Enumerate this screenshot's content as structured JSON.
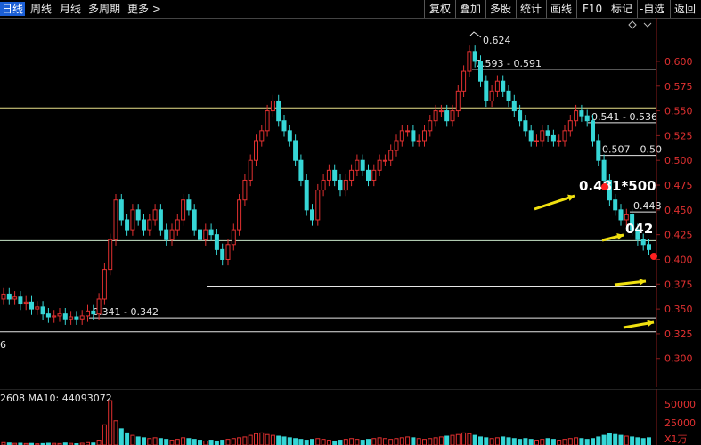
{
  "toolbar": {
    "left": [
      "日线",
      "周线",
      "月线",
      "多周期",
      "更多 >"
    ],
    "right": [
      "复权",
      "叠加",
      "多股",
      "统计",
      "画线",
      "F10",
      "标记",
      "-自选",
      "返回"
    ]
  },
  "chart_data": {
    "type": "candlestick",
    "y_ticks": [
      "0.600",
      "0.575",
      "0.550",
      "0.525",
      "0.500",
      "0.475",
      "0.450",
      "0.425",
      "0.400",
      "0.375",
      "0.350",
      "0.325",
      "0.300"
    ],
    "ylim": [
      0.28,
      0.635
    ],
    "max_label": "0.624",
    "left_edge_label": "6",
    "horizontal_levels": [
      {
        "label": "0.593 - 0.591",
        "y": 0.592,
        "color": "#e6e6e6"
      },
      {
        "label": "",
        "y": 0.553,
        "color": "#e8e08a"
      },
      {
        "label": "0.541 - 0.536",
        "y": 0.538,
        "color": "#e6e6e6"
      },
      {
        "label": "0.507 - 0.50",
        "y": 0.505,
        "color": "#e6e6e6"
      },
      {
        "label": "0.448",
        "y": 0.448,
        "color": "#e6e6e6"
      },
      {
        "label": "",
        "y": 0.419,
        "color": "#c8e6c8"
      },
      {
        "label": "",
        "y": 0.373,
        "color": "#e6e6e6"
      },
      {
        "label": "0.341 - 0.342",
        "y": 0.341,
        "color": "#e6e6e6"
      },
      {
        "label": "",
        "y": 0.327,
        "color": "#e6e6e6"
      }
    ],
    "annotations": [
      {
        "text": "0.481*500",
        "y": 0.475
      },
      {
        "text": "042",
        "y": 0.432
      }
    ],
    "series_close": [
      0.365,
      0.36,
      0.362,
      0.355,
      0.357,
      0.35,
      0.352,
      0.345,
      0.342,
      0.343,
      0.345,
      0.34,
      0.342,
      0.34,
      0.343,
      0.348,
      0.345,
      0.36,
      0.39,
      0.42,
      0.46,
      0.44,
      0.43,
      0.45,
      0.44,
      0.43,
      0.44,
      0.45,
      0.43,
      0.42,
      0.43,
      0.44,
      0.46,
      0.45,
      0.43,
      0.42,
      0.43,
      0.425,
      0.41,
      0.4,
      0.415,
      0.43,
      0.46,
      0.48,
      0.5,
      0.52,
      0.53,
      0.55,
      0.56,
      0.54,
      0.53,
      0.52,
      0.5,
      0.48,
      0.45,
      0.44,
      0.47,
      0.48,
      0.49,
      0.48,
      0.47,
      0.48,
      0.49,
      0.5,
      0.49,
      0.48,
      0.49,
      0.5,
      0.5,
      0.51,
      0.52,
      0.53,
      0.53,
      0.52,
      0.52,
      0.53,
      0.54,
      0.55,
      0.55,
      0.54,
      0.55,
      0.57,
      0.59,
      0.61,
      0.6,
      0.58,
      0.56,
      0.57,
      0.58,
      0.57,
      0.56,
      0.55,
      0.54,
      0.53,
      0.52,
      0.52,
      0.53,
      0.525,
      0.52,
      0.52,
      0.53,
      0.54,
      0.55,
      0.545,
      0.54,
      0.52,
      0.5,
      0.48,
      0.46,
      0.45,
      0.44,
      0.445,
      0.43,
      0.42,
      0.415,
      0.41
    ],
    "volume": {
      "ma_label": "2608  MA10: 44093072",
      "y_ticks": [
        "50000",
        "25000",
        "X1万"
      ],
      "ylim": [
        0,
        65000
      ],
      "bars": [
        3000,
        2500,
        2000,
        2200,
        1800,
        2000,
        1500,
        1800,
        2200,
        2000,
        1800,
        2500,
        2000,
        1600,
        2200,
        3000,
        2500,
        6000,
        25000,
        55000,
        30000,
        20000,
        15000,
        12000,
        10000,
        9000,
        8000,
        9000,
        8000,
        7000,
        6000,
        7000,
        9000,
        8000,
        7000,
        6000,
        5000,
        6000,
        5000,
        6000,
        7000,
        8000,
        9000,
        10000,
        12000,
        14000,
        15000,
        13000,
        12000,
        11000,
        10000,
        9000,
        8000,
        7000,
        6000,
        7000,
        8000,
        7000,
        6000,
        5000,
        6000,
        7000,
        8000,
        7000,
        6000,
        7000,
        8000,
        9000,
        8000,
        7000,
        8000,
        9000,
        10000,
        9000,
        8000,
        7000,
        8000,
        9000,
        10000,
        11000,
        12000,
        13000,
        15000,
        14000,
        12000,
        10000,
        9000,
        8000,
        9000,
        10000,
        9000,
        8000,
        7000,
        8000,
        7000,
        6000,
        7000,
        8000,
        7000,
        6000,
        7000,
        8000,
        9000,
        8000,
        7000,
        8000,
        10000,
        12000,
        14000,
        13000,
        12000,
        11000,
        10000,
        9000,
        8000,
        9000
      ]
    }
  }
}
